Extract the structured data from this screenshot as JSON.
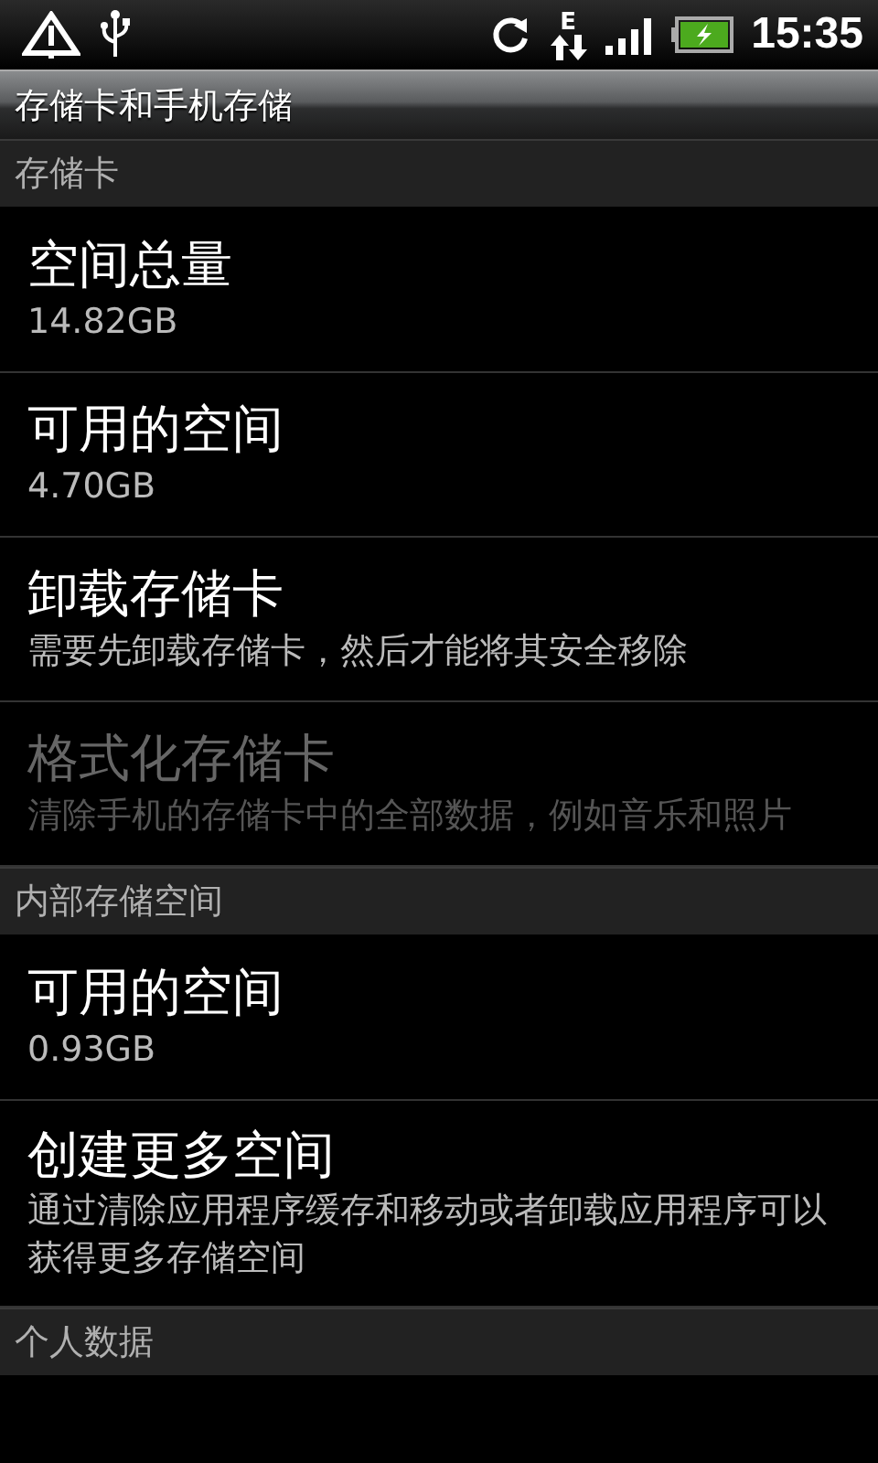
{
  "status_bar": {
    "network_type": "E",
    "time": "15:35",
    "battery_charging": true
  },
  "title": "存储卡和手机存储",
  "sections": [
    {
      "header": "存储卡",
      "items": [
        {
          "title": "空间总量",
          "summary": "14.82GB",
          "disabled": false
        },
        {
          "title": "可用的空间",
          "summary": "4.70GB",
          "disabled": false
        },
        {
          "title": "卸载存储卡",
          "summary": "需要先卸载存储卡，然后才能将其安全移除",
          "disabled": false
        },
        {
          "title": "格式化存储卡",
          "summary": "清除手机的存储卡中的全部数据，例如音乐和照片",
          "disabled": true
        }
      ]
    },
    {
      "header": "内部存储空间",
      "items": [
        {
          "title": "可用的空间",
          "summary": "0.93GB",
          "disabled": false
        },
        {
          "title": "创建更多空间",
          "summary": "通过清除应用程序缓存和移动或者卸载应用程序可以获得更多存储空间",
          "disabled": false
        }
      ]
    },
    {
      "header": "个人数据"
    }
  ]
}
